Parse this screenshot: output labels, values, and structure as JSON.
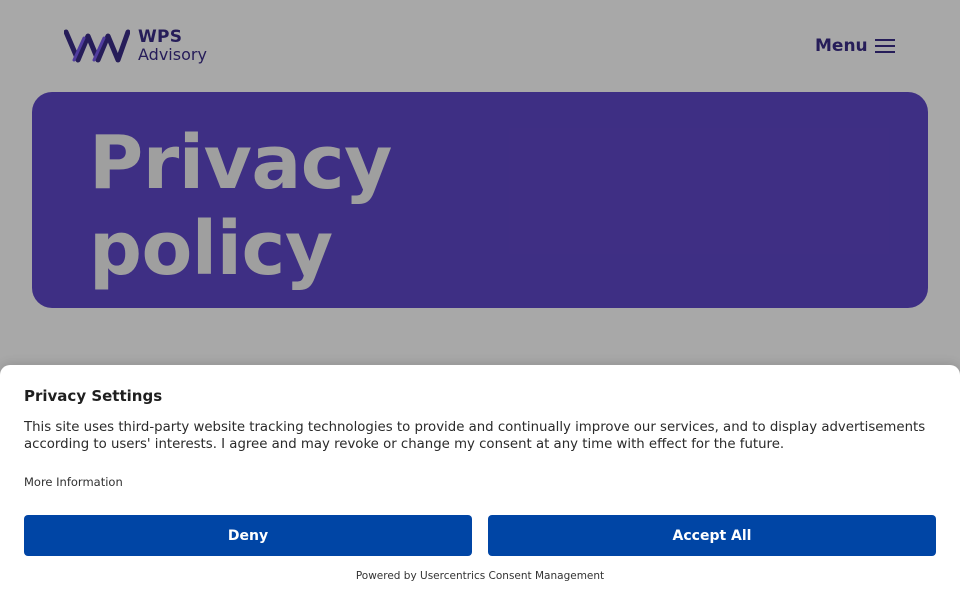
{
  "header": {
    "logo_line1": "WPS",
    "logo_line2": "Advisory",
    "menu_label": "Menu"
  },
  "hero": {
    "title_line1": "Privacy",
    "title_line2": "policy"
  },
  "consent": {
    "title": "Privacy Settings",
    "text": "This site uses third-party website tracking technologies to provide and continually improve our services, and to display advertisements according to users' interests. I agree and may revoke or change my consent at any time with effect for the future.",
    "more_info": "More Information",
    "deny_label": "Deny",
    "accept_label": "Accept All",
    "powered_by": "Powered by Usercentrics Consent Management"
  },
  "colors": {
    "brand_purple": "#5f48c8",
    "brand_navy": "#3a2c88",
    "button_blue": "#0045a5"
  },
  "icons": {
    "logo": "wps-logo-icon",
    "menu": "hamburger-icon"
  }
}
